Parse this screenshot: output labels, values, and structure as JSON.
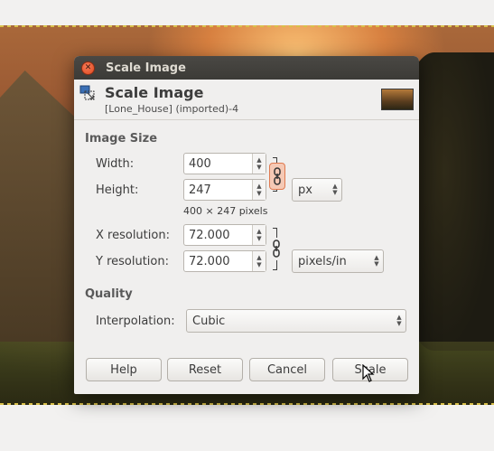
{
  "dialog": {
    "window_title": "Scale Image",
    "header_title": "Scale Image",
    "header_subtitle": "[Lone_House] (imported)-4"
  },
  "image_size": {
    "section": "Image Size",
    "width_label": "Width:",
    "width_value": "400",
    "height_label": "Height:",
    "height_value": "247",
    "pixel_size": "400 × 247 pixels",
    "unit": "px",
    "chain_linked": true
  },
  "resolution": {
    "x_label": "X resolution:",
    "x_value": "72.000",
    "y_label": "Y resolution:",
    "y_value": "72.000",
    "unit": "pixels/in",
    "chain_linked": true
  },
  "quality": {
    "section": "Quality",
    "interpolation_label": "Interpolation:",
    "interpolation_value": "Cubic"
  },
  "buttons": {
    "help": "Help",
    "reset": "Reset",
    "cancel": "Cancel",
    "scale": "Scale"
  },
  "icons": {
    "close": "close-icon",
    "scale": "scale-image-icon",
    "chain": "chain-link-icon",
    "spin": "spin-arrows-icon",
    "dropdown": "dropdown-arrows-icon",
    "cursor": "mouse-pointer-icon"
  },
  "colors": {
    "titlebar": "#3c3b37",
    "close_button": "#df4a1f",
    "chain_active": "#f5c9b5"
  }
}
